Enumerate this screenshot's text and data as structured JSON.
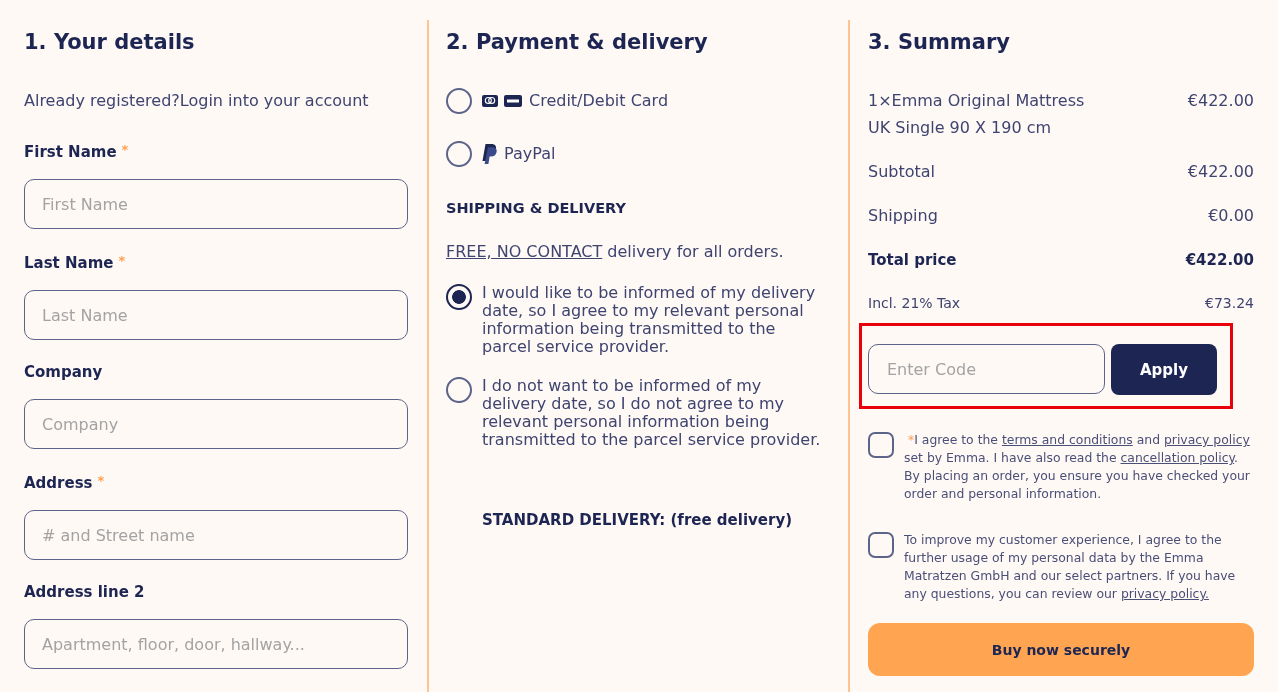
{
  "details": {
    "title": "1. Your details",
    "login_prompt": "Already registered?Login into your account",
    "fields": [
      {
        "label": "First Name",
        "required_mark": "*",
        "placeholder": "First Name"
      },
      {
        "label": "Last Name",
        "required_mark": "*",
        "placeholder": "Last Name"
      },
      {
        "label": "Company",
        "placeholder": "Company"
      },
      {
        "label": "Address",
        "required_mark": "*",
        "placeholder": "# and Street name"
      },
      {
        "label": "Address line 2",
        "placeholder": "Apartment, floor, door, hallway..."
      }
    ]
  },
  "payment": {
    "title": "2. Payment & delivery",
    "methods": [
      {
        "kind": "card",
        "label": "Credit/Debit Card",
        "selected": false
      },
      {
        "kind": "paypal",
        "label": "PayPal",
        "selected": false
      }
    ],
    "shipping_heading": "SHIPPING & DELIVERY",
    "delivery_note": [
      {
        "kind": "link",
        "text": "FREE, NO CONTACT"
      },
      {
        "kind": "text",
        "text": " delivery for all orders."
      }
    ],
    "notification_options": [
      {
        "text": "I would like to be informed of my delivery date, so I agree to my relevant personal information being transmitted to the parcel service provider.",
        "selected": true
      },
      {
        "text": "I do not want to be informed of my delivery date, so I do not agree to my relevant personal information being transmitted to the parcel service provider.",
        "selected": false
      }
    ],
    "delivery_method": "STANDARD DELIVERY: (free delivery)"
  },
  "summary": {
    "title": "3. Summary",
    "item": {
      "name": "1×Emma Original Mattress",
      "variant": "UK Single 90 X 190 cm",
      "price": "€422.00"
    },
    "rows": [
      {
        "kind": "normal",
        "label": "Subtotal",
        "value": "€422.00"
      },
      {
        "kind": "normal",
        "label": "Shipping",
        "value": "€0.00"
      },
      {
        "kind": "total",
        "label": "Total price",
        "value": "€422.00"
      },
      {
        "kind": "tax",
        "label": "Incl. 21% Tax",
        "value": "€73.24"
      }
    ],
    "coupon": {
      "highlighted": true,
      "placeholder": "Enter Code",
      "button": "Apply"
    },
    "consents": [
      {
        "checked": false,
        "required_mark": "*",
        "parts": [
          {
            "kind": "text",
            "text": "I agree to the "
          },
          {
            "kind": "link",
            "text": "terms and conditions"
          },
          {
            "kind": "text",
            "text": " and "
          },
          {
            "kind": "link",
            "text": "privacy policy"
          },
          {
            "kind": "text",
            "text": " set by Emma. I have also read the "
          },
          {
            "kind": "link",
            "text": "cancellation policy"
          },
          {
            "kind": "text",
            "text": ". By placing an order, you ensure you have checked your order and personal information."
          }
        ]
      },
      {
        "checked": false,
        "parts": [
          {
            "kind": "text",
            "text": "To improve my customer experience, I agree to the further usage of my personal data by the Emma Matratzen GmbH and our select partners. If you have any questions, you can review our "
          },
          {
            "kind": "link",
            "text": "privacy policy."
          }
        ]
      }
    ],
    "buy_button": "Buy now securely"
  }
}
